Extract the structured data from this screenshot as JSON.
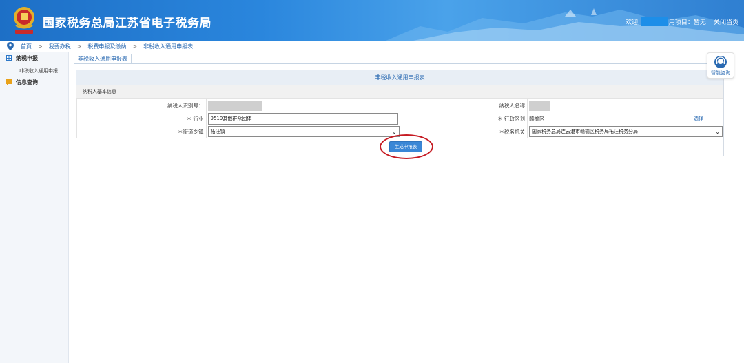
{
  "header": {
    "title": "国家税务总局江苏省电子税务局",
    "welcome": "欢迎,",
    "user_suffix": "用项目：暂无",
    "close_page": "关闭当页",
    "emblem_caption": "中国税务"
  },
  "breadcrumb": {
    "items": [
      "首页",
      "我要办税",
      "税费申报及缴纳",
      "非税收入通用申报表"
    ],
    "separator": ">"
  },
  "sidebar": {
    "groups": [
      {
        "label": "纳税申报",
        "icon": "grid-icon",
        "color": "#2d78c8",
        "subitems": [
          "非税收入通用申报"
        ]
      },
      {
        "label": "信息查询",
        "icon": "chat-icon",
        "color": "#e9a21a",
        "subitems": []
      }
    ]
  },
  "tab": {
    "label": "非税收入通用申报表"
  },
  "form": {
    "title": "非税收入通用申报表",
    "section": "纳税人基本信息",
    "taxpayer_id_label": "纳税人识别号：",
    "taxpayer_name_label": "纳税人名称",
    "industry_label": "＊ 行业",
    "industry_value": "9519其他群众团体",
    "admin_region_label": "＊ 行政区划",
    "admin_region_value": "赣榆区",
    "choose_label": "选择",
    "street_label": "＊街道乡镇",
    "street_value": "柘汪镇",
    "tax_office_label": "＊税务机关",
    "tax_office_value": "国家税务总局连云港市赣榆区税务局柘汪税务分局",
    "generate_button": "生成申报表"
  },
  "help": {
    "label": "智能咨询"
  },
  "colors": {
    "brand": "#1d6fc6",
    "accent": "#3a87d6",
    "highlight_circle": "#c61b23"
  }
}
